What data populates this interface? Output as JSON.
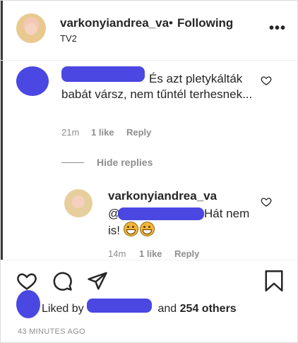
{
  "post_header": {
    "username": "varkonyiandrea_va",
    "separator": "•",
    "follow_status": "Following",
    "subtitle": "TV2",
    "more_icon": "more-options-icon"
  },
  "comments": {
    "comment": {
      "text": "És azt pletykálták babát vársz, nem tűntél terhesnek...",
      "age": "21m",
      "likes": "1 like",
      "reply_label": "Reply"
    },
    "hide_replies_label": "Hide replies",
    "reply": {
      "username": "varkonyiandrea_va",
      "text": "Hát nem is!",
      "emojis": [
        "grin-emoji",
        "grin-emoji"
      ],
      "age": "14m",
      "likes": "1 like",
      "reply_label": "Reply"
    }
  },
  "actions": {
    "icons": [
      "heart-icon",
      "comment-icon",
      "share-icon",
      "bookmark-icon"
    ],
    "liked_by_prefix": "Liked by",
    "liked_by_suffix_and": "and",
    "liked_by_count": "254 others",
    "time_ago": "43 MINUTES AGO"
  },
  "colors": {
    "text": "#262626",
    "muted": "#8e8e8e",
    "redaction": "#3b37e0"
  }
}
